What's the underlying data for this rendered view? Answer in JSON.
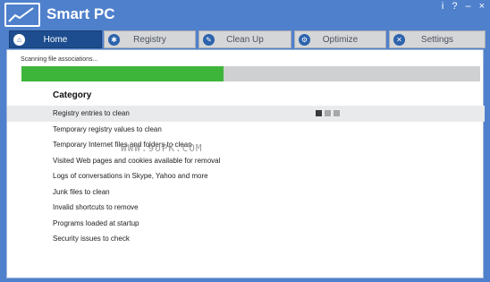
{
  "app": {
    "title": "Smart PC"
  },
  "window_controls": {
    "info": "i",
    "help": "?",
    "minimize": "–",
    "close": "×"
  },
  "tabs": [
    {
      "label": "Home",
      "active": true,
      "icon": "house-icon"
    },
    {
      "label": "Registry",
      "active": false,
      "icon": "registry-icon"
    },
    {
      "label": "Clean Up",
      "active": false,
      "icon": "wrench-icon"
    },
    {
      "label": "Optimize",
      "active": false,
      "icon": "gear-icon"
    },
    {
      "label": "Settings",
      "active": false,
      "icon": "tools-icon"
    }
  ],
  "scan": {
    "status_text": "Scanning file associations...",
    "progress": 0.44
  },
  "category": {
    "heading": "Category",
    "items": [
      {
        "label": "Registry entries to clean"
      },
      {
        "label": "Temporary registry values to clean"
      },
      {
        "label": "Temporary Internet files and folders to clean"
      },
      {
        "label": "Visited Web pages and cookies available for removal"
      },
      {
        "label": "Logs of conversations in Skype, Yahoo and more"
      },
      {
        "label": "Junk files to clean"
      },
      {
        "label": "Invalid shortcuts to remove"
      },
      {
        "label": "Programs loaded at startup"
      },
      {
        "label": "Security issues to check"
      }
    ]
  },
  "watermark": "WWW.9UPK.COM",
  "colors": {
    "titlebar": "#4f80cc",
    "active_tab": "#1d4d8e",
    "progress_fill": "#3db53a",
    "progress_track": "#cfd0d2"
  }
}
